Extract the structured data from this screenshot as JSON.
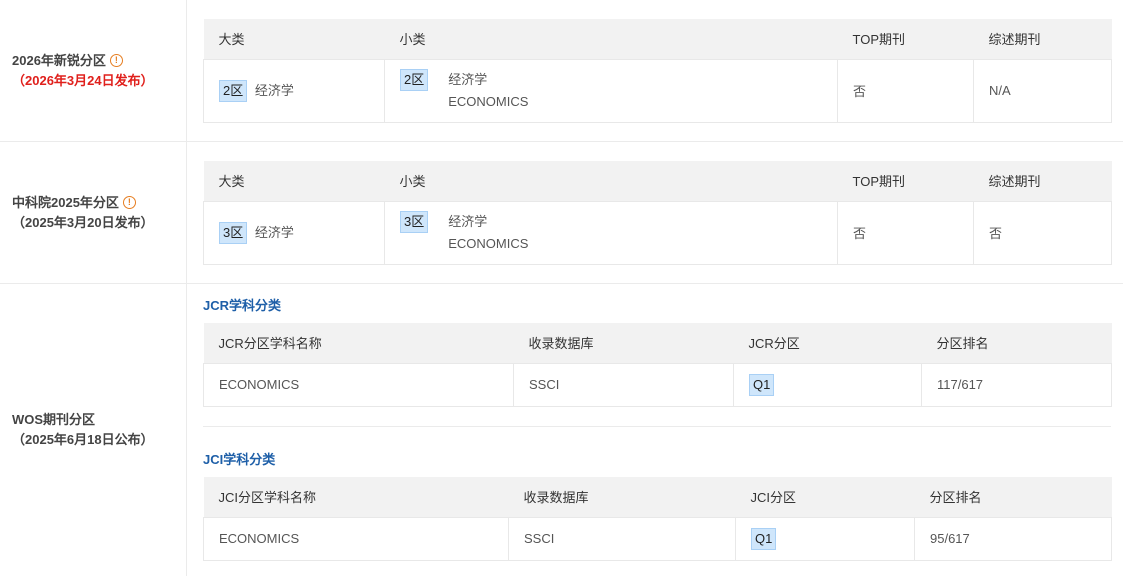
{
  "rows": {
    "xinrui": {
      "label_line1": "2026年新锐分区",
      "label_line2": "（2026年3月24日发布）",
      "headers": [
        "大类",
        "小类",
        "TOP期刊",
        "综述期刊"
      ],
      "big_zone": "2区",
      "big_subject": "经济学",
      "small_zone": "2区",
      "small_subject_cn": "经济学",
      "small_subject_en": "ECONOMICS",
      "top": "否",
      "review": "N/A"
    },
    "cas": {
      "label_line1": "中科院2025年分区",
      "label_line2": "（2025年3月20日发布）",
      "headers": [
        "大类",
        "小类",
        "TOP期刊",
        "综述期刊"
      ],
      "big_zone": "3区",
      "big_subject": "经济学",
      "small_zone": "3区",
      "small_subject_cn": "经济学",
      "small_subject_en": "ECONOMICS",
      "top": "否",
      "review": "否"
    },
    "wos": {
      "label_line1": "WOS期刊分区",
      "label_line2": "（2025年6月18日公布）",
      "jcr": {
        "title": "JCR学科分类",
        "headers": [
          "JCR分区学科名称",
          "收录数据库",
          "JCR分区",
          "分区排名"
        ],
        "subject": "ECONOMICS",
        "database": "SSCI",
        "zone": "Q1",
        "rank": "117/617"
      },
      "jci": {
        "title": "JCI学科分类",
        "headers": [
          "JCI分区学科名称",
          "收录数据库",
          "JCI分区",
          "分区排名"
        ],
        "subject": "ECONOMICS",
        "database": "SSCI",
        "zone": "Q1",
        "rank": "95/617"
      }
    }
  },
  "icons": {
    "info": "info-circle-icon"
  },
  "colors": {
    "accent_blue": "#1e5fa8",
    "date_red": "#e0201c",
    "badge_bg": "#cfe6fb",
    "info_orange": "#e67e22"
  }
}
